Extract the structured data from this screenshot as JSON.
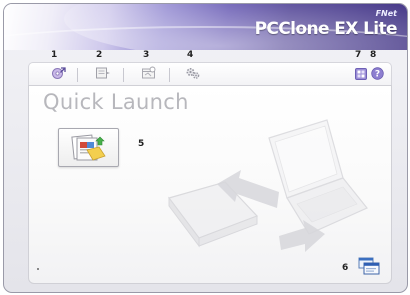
{
  "app": {
    "brand_sub": "FNet",
    "title": "PCClone EX Lite"
  },
  "callouts": {
    "c1": "1",
    "c2": "2",
    "c3": "3",
    "c4": "4",
    "c5": "5",
    "c6": "6",
    "c7": "7",
    "c8": "8"
  },
  "main": {
    "heading": "Quick Launch"
  },
  "icons": {
    "toolbar_1": "backup-icon",
    "toolbar_2": "restore-icon",
    "toolbar_3": "schedule-icon",
    "toolbar_4": "settings-icon",
    "toolbar_7": "options-icon",
    "toolbar_8": "help-icon",
    "launch": "quick-backup-icon",
    "bottom": "windows-icon"
  },
  "colors": {
    "title_gradient_dark": "#3d2f82",
    "title_gradient_light": "#cfc9ec",
    "heading_text": "#b7b7bc",
    "help_icon": "#8d7fd0"
  }
}
